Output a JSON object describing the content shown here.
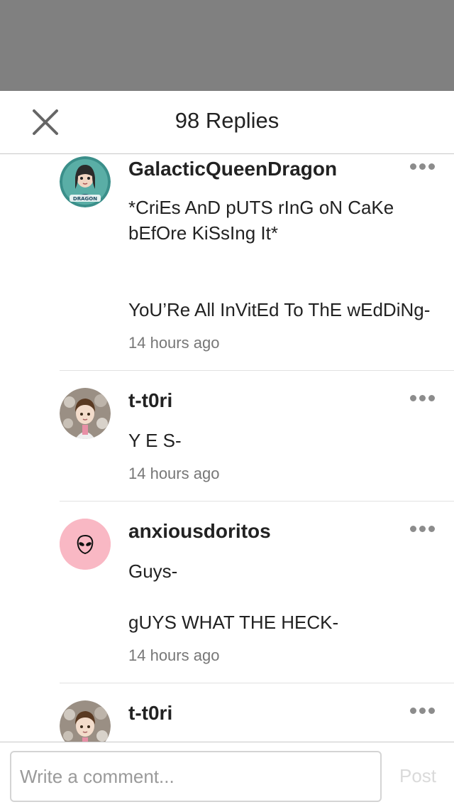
{
  "header": {
    "title": "98 Replies",
    "close_icon": "close-icon"
  },
  "replies": [
    {
      "username": "GalacticQueenDragon",
      "body": "*CriEs AnD pUTS rInG oN CaKe\nbEfOre KiSsIng It*\n\n\nYoU’Re All InVitEd To ThE wEdDiNg-",
      "time": "14 hours ago",
      "avatar": "galactic-dragon-avatar",
      "avatar_badge": "DRAGON",
      "avatar_color": "#3b8f8a"
    },
    {
      "username": "t-t0ri",
      "body": "Y E S-",
      "time": "14 hours ago",
      "avatar": "anime-boy-avatar",
      "avatar_color": "#9a8f84"
    },
    {
      "username": "anxiousdoritos",
      "body": "Guys-\n\ngUYS WHAT THE HECK-",
      "time": "14 hours ago",
      "avatar": "alien-avatar",
      "avatar_color": "#f9b8c4"
    },
    {
      "username": "t-t0ri",
      "avatar": "anime-boy-avatar",
      "avatar_color": "#9a8f84"
    }
  ],
  "composer": {
    "placeholder": "Write a comment...",
    "value": "",
    "post_label": "Post"
  },
  "colors": {
    "top_overlay": "#808080",
    "divider": "#e2e2e2",
    "muted_text": "#777777",
    "post_disabled": "#dadada"
  }
}
